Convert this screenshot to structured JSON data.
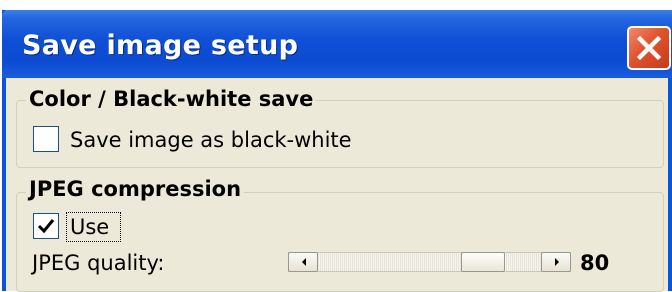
{
  "window": {
    "title": "Save image setup",
    "colors": {
      "titlebar": "#0c4bd2",
      "title_text": "#ffffff",
      "close_button": "#e0532f",
      "dialog_background": "#ece9d8"
    }
  },
  "color_group": {
    "legend": "Color / Black-white save",
    "save_bw": {
      "label": "Save image as black-white",
      "checked": false
    }
  },
  "jpeg_group": {
    "legend": "JPEG compression",
    "use": {
      "label": "Use",
      "checked": true
    },
    "quality": {
      "label": "JPEG quality:",
      "value": "80",
      "level_fraction": 0.8,
      "left_arrow_icon": "scroll-left-icon",
      "right_arrow_icon": "scroll-right-icon"
    }
  }
}
